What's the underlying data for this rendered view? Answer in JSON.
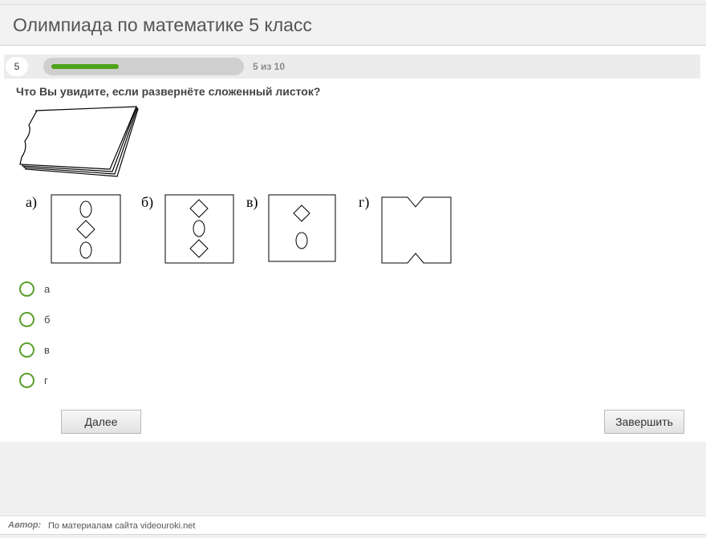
{
  "header": {
    "title": "Олимпиада по математике 5 класс"
  },
  "progress": {
    "question_number": "5",
    "text": "5 из 10",
    "fraction": 0.5
  },
  "question": {
    "text": "Что Вы увидите, если развернёте сложенный листок?"
  },
  "figure_labels": [
    "а)",
    "б)",
    "в)",
    "г)"
  ],
  "answers": [
    {
      "label": "а"
    },
    {
      "label": "б"
    },
    {
      "label": "в"
    },
    {
      "label": "г"
    }
  ],
  "buttons": {
    "next": "Далее",
    "finish": "Завершить"
  },
  "footer": {
    "author_label": "Автор:",
    "author_value": "По материалам сайта videouroki.net"
  },
  "colors": {
    "accent": "#4fa31a",
    "radio": "#5aa02c"
  }
}
